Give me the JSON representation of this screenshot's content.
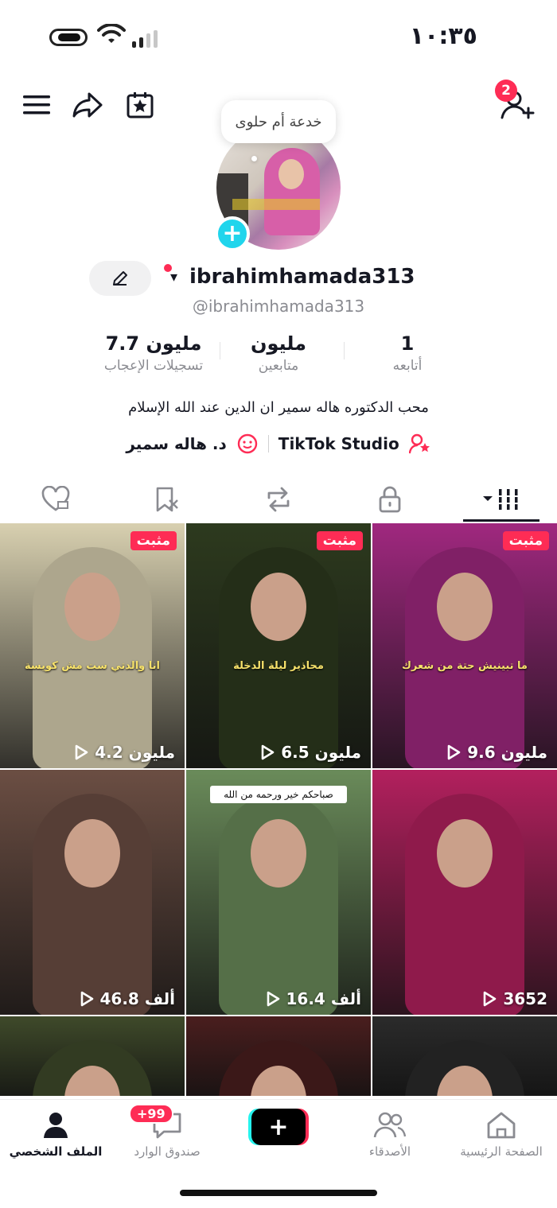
{
  "status_bar": {
    "time": "١٠:٣٥"
  },
  "header": {
    "friend_requests_badge": "2",
    "story_bubble": "خدعة أم حلوى"
  },
  "profile": {
    "username": "ibrahimhamada313",
    "handle": "@ibrahimhamada313",
    "stats": {
      "following": {
        "value": "1",
        "label": "أتابعه"
      },
      "followers": {
        "value": "مليون",
        "label": "متابعين"
      },
      "likes": {
        "value": "7.7 مليون",
        "label": "تسجيلات الإعجاب"
      }
    },
    "bio": "محب الدكتوره هاله سمير ان الدين عند الله الإسلام",
    "links": {
      "studio": "TikTok Studio",
      "linked_account": "د. هاله سمير"
    }
  },
  "tabs": [
    {
      "icon": "grid-icon",
      "active": true
    },
    {
      "icon": "lock-icon"
    },
    {
      "icon": "repost-icon"
    },
    {
      "icon": "bookmark-icon"
    },
    {
      "icon": "liked-icon"
    }
  ],
  "videos": [
    {
      "pinned_label": "مثبت",
      "views": "9.6 مليون",
      "caption": "ما تبينيش حتة من شعرك",
      "bg": "#a0287f"
    },
    {
      "pinned_label": "مثبت",
      "views": "6.5 مليون",
      "caption": "محاذير ليلة الدخلة",
      "bg": "#2d3a1e"
    },
    {
      "pinned_label": "مثبت",
      "views": "4.2 مليون",
      "caption": "انا والدتي ست مش كويسة",
      "bg": "#d8d0b0"
    },
    {
      "pinned_label": "",
      "views": "3652",
      "caption": "",
      "bg": "#b3205e"
    },
    {
      "pinned_label": "",
      "views": "16.4 ألف",
      "caption": "",
      "top_text": "صباحكم خير ورحمه من الله",
      "bg": "#6a8b5a"
    },
    {
      "pinned_label": "",
      "views": "46.8 ألف",
      "caption": "",
      "bg": "#6b4e43"
    },
    {
      "pinned_label": "",
      "views": "",
      "caption": "",
      "bg": "#2b2b2b"
    },
    {
      "pinned_label": "",
      "views": "",
      "caption": "",
      "bg": "#4a1e1e"
    },
    {
      "pinned_label": "",
      "views": "",
      "caption": "",
      "bg": "#3f4a2a"
    }
  ],
  "bottom_nav": {
    "home": "الصفحة الرئيسية",
    "friends": "الأصدقاء",
    "inbox": "صندوق الوارد",
    "inbox_badge": "+99",
    "profile": "الملف الشخصي"
  },
  "colors": {
    "accent": "#fe2c55",
    "cyan": "#25f4ee",
    "text": "#161823",
    "muted": "#8a8b91"
  }
}
